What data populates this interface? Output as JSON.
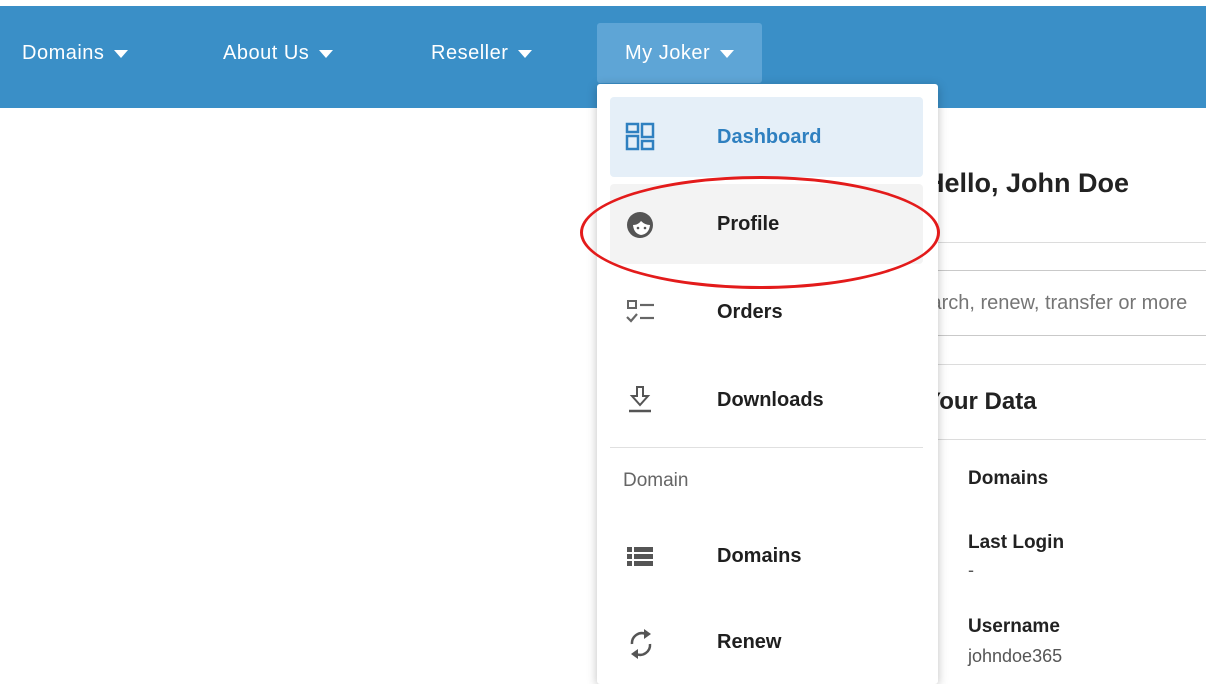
{
  "nav": {
    "items": [
      {
        "label": "Domains"
      },
      {
        "label": "About Us"
      },
      {
        "label": "Reseller"
      },
      {
        "label": "My Joker"
      }
    ]
  },
  "dropdown": {
    "items": [
      {
        "label": "Dashboard",
        "icon": "dashboard-icon"
      },
      {
        "label": "Profile",
        "icon": "profile-icon"
      },
      {
        "label": "Orders",
        "icon": "orders-icon"
      },
      {
        "label": "Downloads",
        "icon": "downloads-icon"
      }
    ],
    "section_label": "Domain",
    "domain_items": [
      {
        "label": "Domains",
        "icon": "list-icon"
      },
      {
        "label": "Renew",
        "icon": "renew-icon"
      }
    ]
  },
  "main": {
    "greeting": "Hello, John Doe",
    "search_placeholder": "Search, renew, transfer or more",
    "your_data_title": "Your Data",
    "fields": [
      {
        "label": "Domains",
        "value": ""
      },
      {
        "label": "Last Login",
        "value": "-"
      },
      {
        "label": "Username",
        "value": "johndoe365"
      }
    ]
  },
  "colors": {
    "navbar": "#3a8fc7",
    "active_nav": "#5ea5d6",
    "selected_item": "#e5eff8",
    "accent_text": "#2f80c0",
    "annotation": "#e31b1b"
  }
}
